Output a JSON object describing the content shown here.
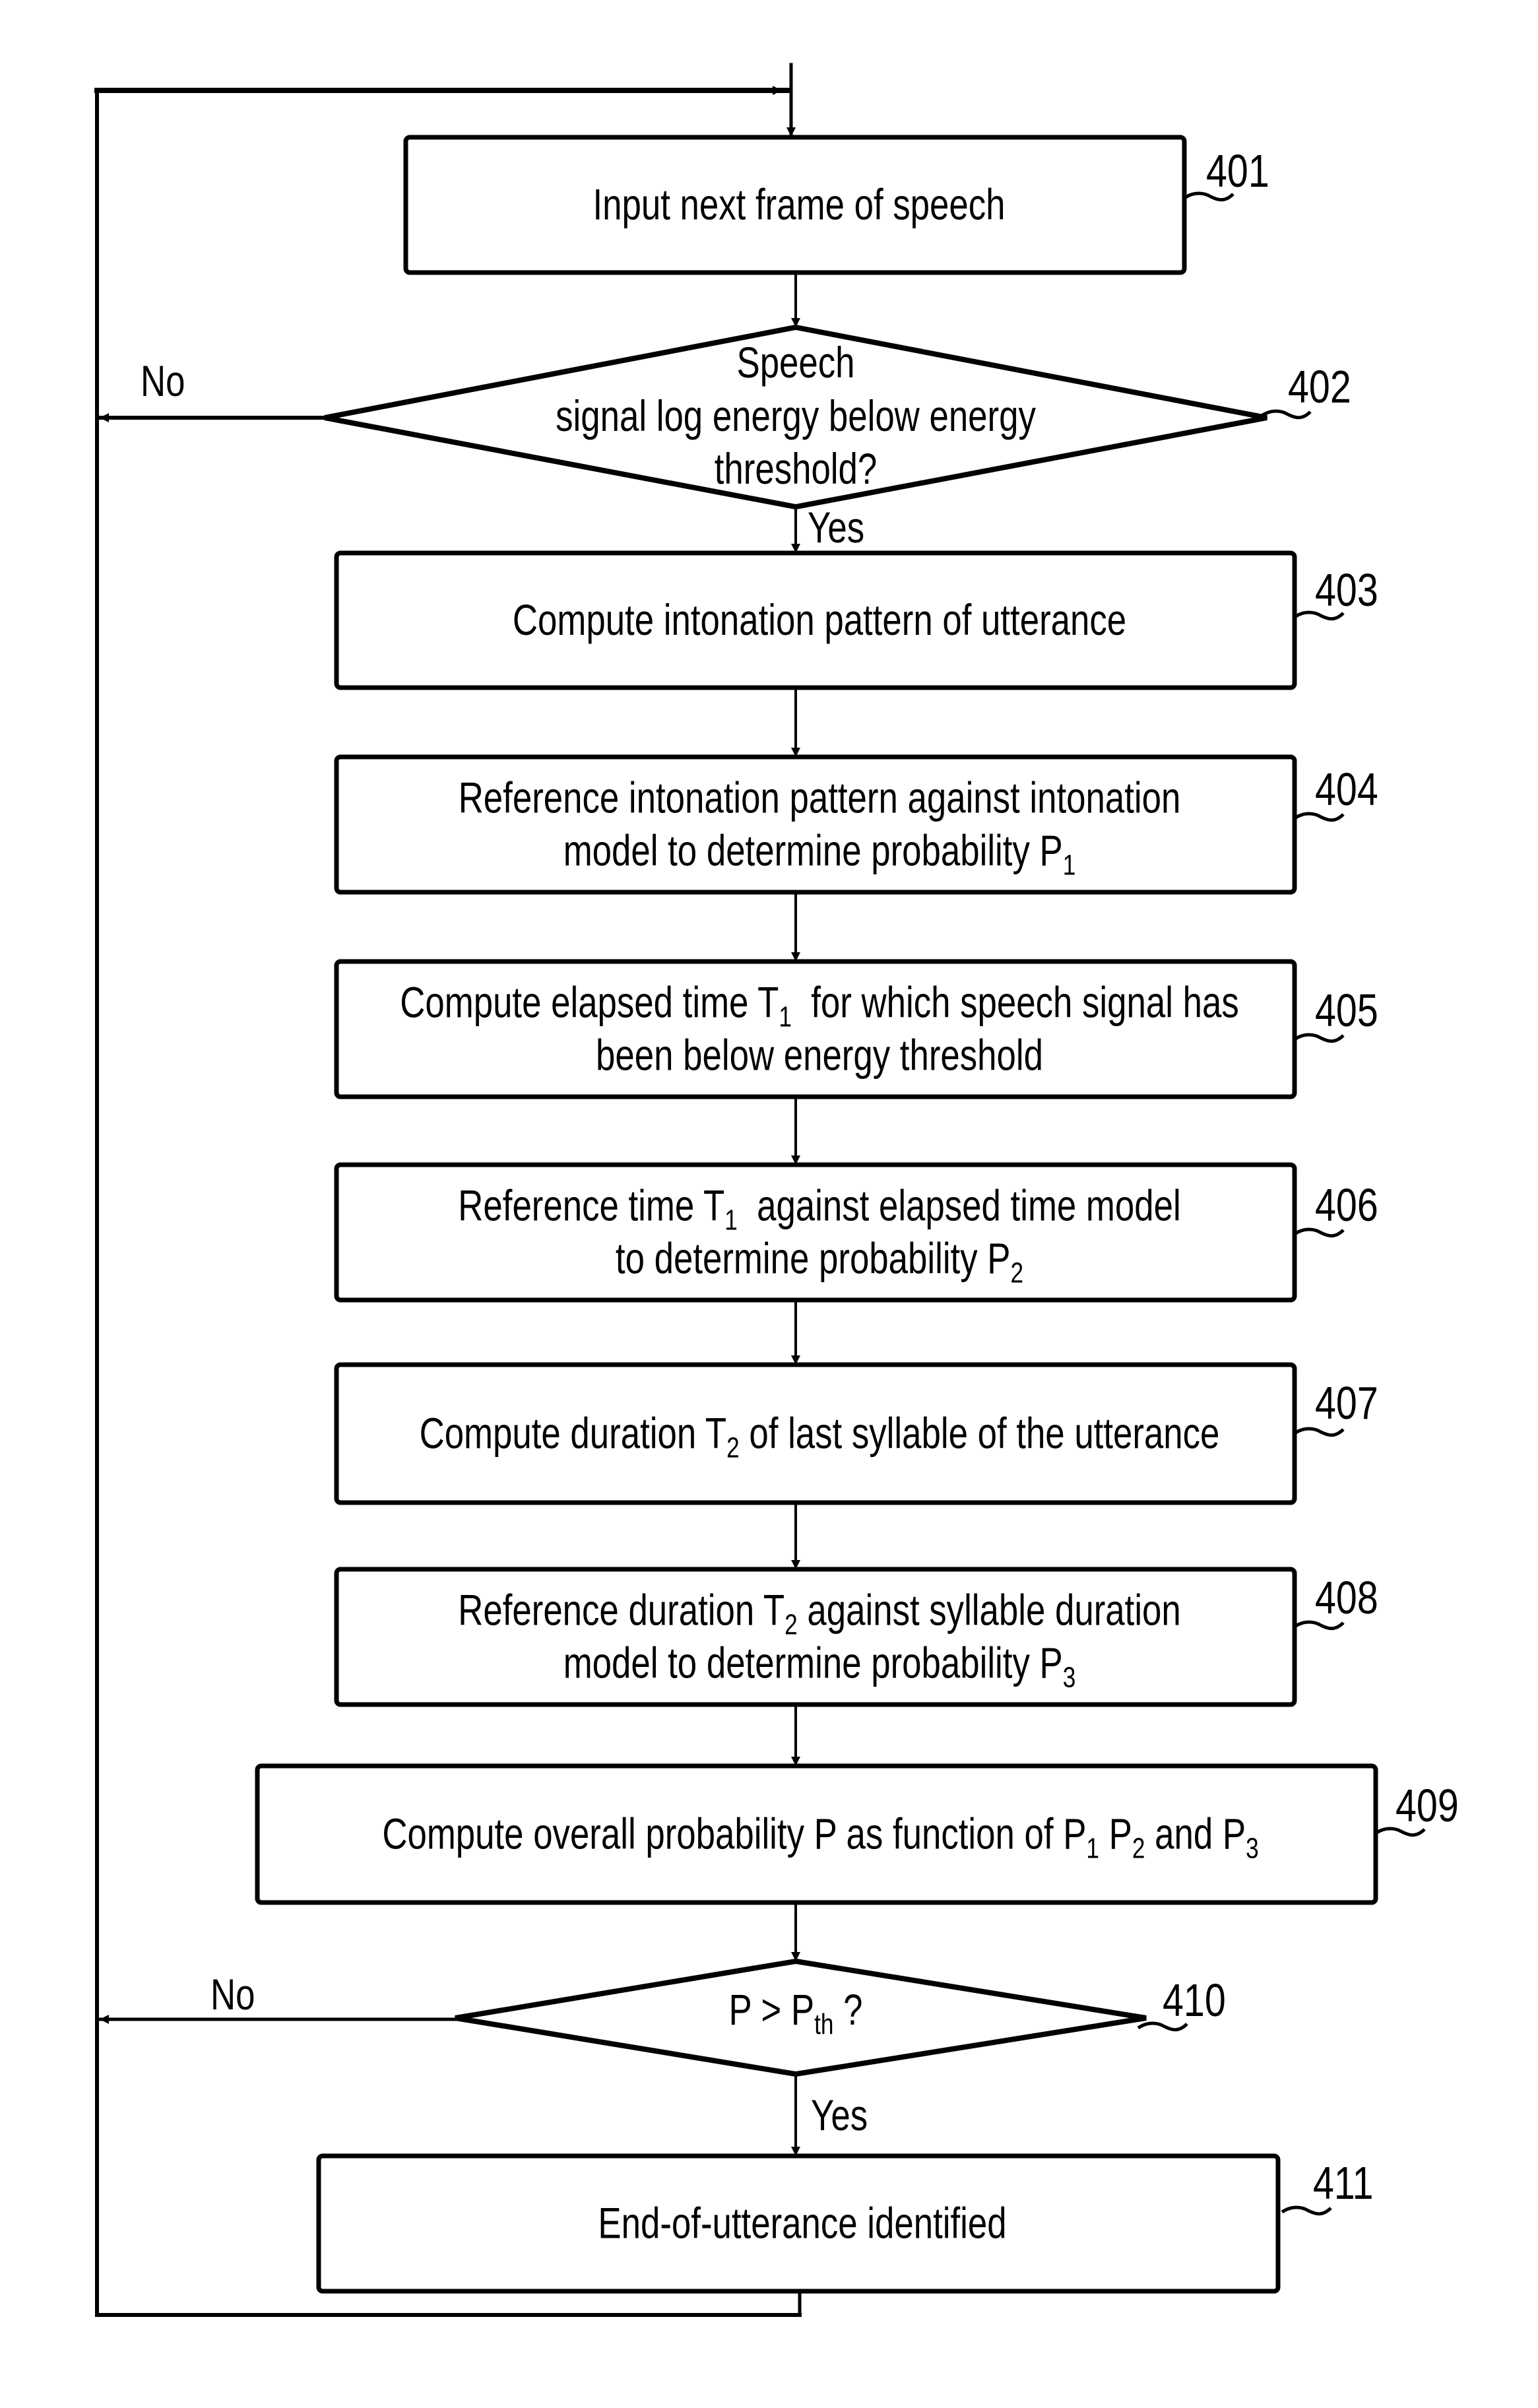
{
  "figure": {
    "colors": {
      "ink": "#000000",
      "paper": "#ffffff"
    },
    "nodes": [
      {
        "id": "401",
        "type": "process",
        "ref": "401",
        "lines": [
          [
            {
              "t": "Input next frame of speech"
            }
          ]
        ]
      },
      {
        "id": "402",
        "type": "decision",
        "ref": "402",
        "lines": [
          [
            {
              "t": "Speech"
            }
          ],
          [
            {
              "t": "signal log energy below energy"
            }
          ],
          [
            {
              "t": "threshold?"
            }
          ]
        ]
      },
      {
        "id": "403",
        "type": "process",
        "ref": "403",
        "lines": [
          [
            {
              "t": "Compute intonation pattern of utterance"
            }
          ]
        ]
      },
      {
        "id": "404",
        "type": "process",
        "ref": "404",
        "lines": [
          [
            {
              "t": "Reference intonation pattern against intonation"
            }
          ],
          [
            {
              "t": "model to determine probability P"
            },
            {
              "t": "1",
              "sub": true
            }
          ]
        ]
      },
      {
        "id": "405",
        "type": "process",
        "ref": "405",
        "lines": [
          [
            {
              "t": "Compute elapsed time T"
            },
            {
              "t": "1",
              "sub": true
            },
            {
              "t": "  for which speech signal has"
            }
          ],
          [
            {
              "t": "been below energy threshold"
            }
          ]
        ]
      },
      {
        "id": "406",
        "type": "process",
        "ref": "406",
        "lines": [
          [
            {
              "t": "Reference time T"
            },
            {
              "t": "1",
              "sub": true
            },
            {
              "t": "  against elapsed time model"
            }
          ],
          [
            {
              "t": "to determine probability P"
            },
            {
              "t": "2",
              "sub": true
            }
          ]
        ]
      },
      {
        "id": "407",
        "type": "process",
        "ref": "407",
        "lines": [
          [
            {
              "t": "Compute duration T"
            },
            {
              "t": "2",
              "sub": true
            },
            {
              "t": " of last syllable of the utterance"
            }
          ]
        ]
      },
      {
        "id": "408",
        "type": "process",
        "ref": "408",
        "lines": [
          [
            {
              "t": "Reference duration T"
            },
            {
              "t": "2",
              "sub": true
            },
            {
              "t": " against syllable duration"
            }
          ],
          [
            {
              "t": "model to determine probability P"
            },
            {
              "t": "3",
              "sub": true
            }
          ]
        ]
      },
      {
        "id": "409",
        "type": "process",
        "ref": "409",
        "lines": [
          [
            {
              "t": "Compute overall probability P as function of P"
            },
            {
              "t": "1",
              "sub": true
            },
            {
              "t": " P"
            },
            {
              "t": "2",
              "sub": true
            },
            {
              "t": " and P"
            },
            {
              "t": "3",
              "sub": true
            }
          ]
        ]
      },
      {
        "id": "410",
        "type": "decision",
        "ref": "410",
        "lines": [
          [
            {
              "t": "P > P"
            },
            {
              "t": "th",
              "sub": true
            },
            {
              "t": " ?"
            }
          ]
        ]
      },
      {
        "id": "411",
        "type": "process",
        "ref": "411",
        "lines": [
          [
            {
              "t": "End-of-utterance identified"
            }
          ]
        ]
      }
    ],
    "branches": [
      {
        "from": "402",
        "label": "No",
        "target": "loop"
      },
      {
        "from": "402",
        "label": "Yes",
        "target": "403"
      },
      {
        "from": "410",
        "label": "No",
        "target": "loop"
      },
      {
        "from": "410",
        "label": "Yes",
        "target": "411"
      }
    ],
    "edges": [
      [
        "entry",
        "401"
      ],
      [
        "401",
        "402"
      ],
      [
        "402",
        "403"
      ],
      [
        "403",
        "404"
      ],
      [
        "404",
        "405"
      ],
      [
        "405",
        "406"
      ],
      [
        "406",
        "407"
      ],
      [
        "407",
        "408"
      ],
      [
        "408",
        "409"
      ],
      [
        "409",
        "410"
      ],
      [
        "410",
        "411"
      ],
      [
        "411",
        "loop"
      ],
      [
        "loop",
        "401"
      ]
    ]
  }
}
